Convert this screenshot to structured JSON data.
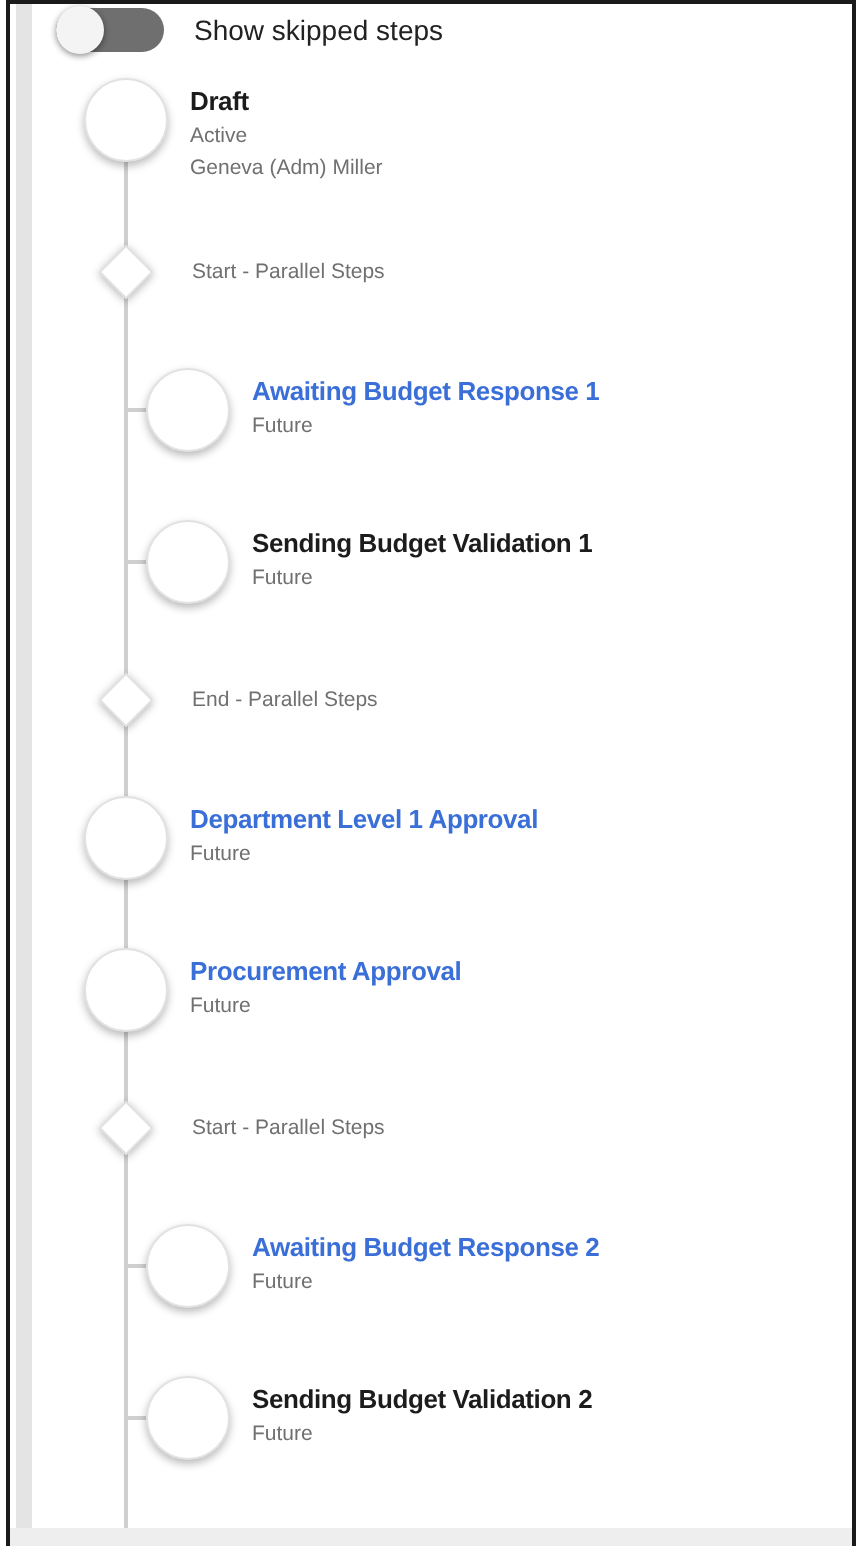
{
  "toggle": {
    "label": "Show skipped steps",
    "on": false
  },
  "steps": [
    {
      "kind": "step",
      "title": "Draft",
      "link": false,
      "lines": [
        "Active",
        "Geneva (Adm) Miller"
      ]
    },
    {
      "kind": "gateway",
      "label": "Start - Parallel Steps",
      "children": [
        {
          "kind": "step",
          "title": "Awaiting Budget Response 1",
          "link": true,
          "lines": [
            "Future"
          ]
        },
        {
          "kind": "step",
          "title": "Sending Budget Validation 1",
          "link": false,
          "lines": [
            "Future"
          ]
        }
      ]
    },
    {
      "kind": "gateway",
      "label": "End - Parallel Steps"
    },
    {
      "kind": "step",
      "title": "Department Level 1 Approval",
      "link": true,
      "lines": [
        "Future"
      ]
    },
    {
      "kind": "step",
      "title": "Procurement Approval",
      "link": true,
      "lines": [
        "Future"
      ]
    },
    {
      "kind": "gateway",
      "label": "Start - Parallel Steps",
      "children": [
        {
          "kind": "step",
          "title": "Awaiting Budget Response 2",
          "link": true,
          "lines": [
            "Future"
          ]
        },
        {
          "kind": "step",
          "title": "Sending Budget Validation 2",
          "link": false,
          "lines": [
            "Future"
          ]
        }
      ]
    }
  ]
}
